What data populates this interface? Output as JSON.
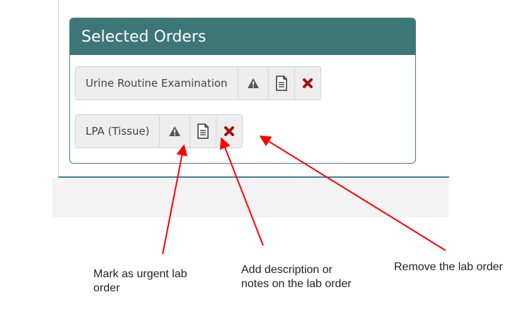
{
  "panel": {
    "title": "Selected Orders"
  },
  "orders": [
    {
      "name": "Urine Routine Examination",
      "urgent_icon": "warning-triangle-icon",
      "notes_icon": "document-icon",
      "remove_icon": "red-x-icon"
    },
    {
      "name": "LPA (Tissue)",
      "urgent_icon": "warning-triangle-icon",
      "notes_icon": "document-icon",
      "remove_icon": "red-x-icon"
    }
  ],
  "annotations": {
    "urgent": "Mark as urgent lab order",
    "notes": "Add description or notes on the lab order",
    "remove": "Remove the lab order"
  },
  "colors": {
    "header": "#3d7676",
    "remove": "#a50f0f",
    "arrow": "#ff0000"
  }
}
